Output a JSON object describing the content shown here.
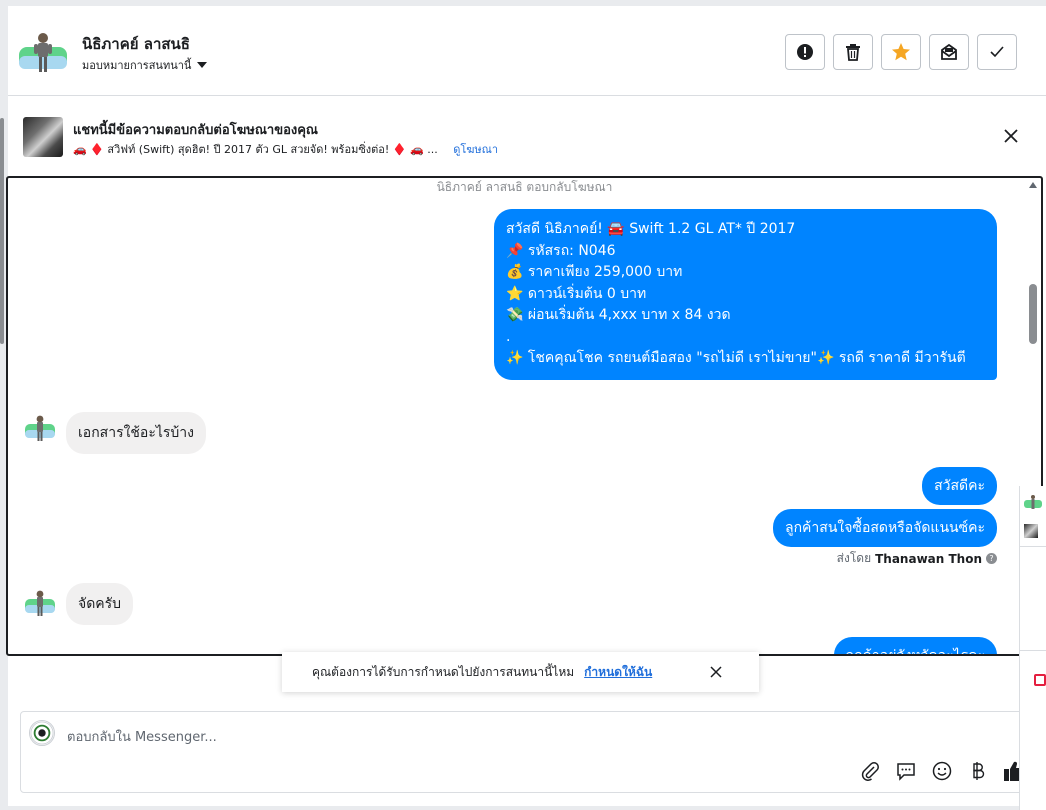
{
  "header": {
    "contact_name": "นิธิภาคย์ ลาสนธิ",
    "assign_label": "มอบหมายการสนทนานี้",
    "buttons": [
      {
        "name": "report-button",
        "icon": "alert-icon"
      },
      {
        "name": "delete-button",
        "icon": "trash-icon"
      },
      {
        "name": "star-button",
        "icon": "star-icon",
        "color": "#f5a623"
      },
      {
        "name": "mark-unread-button",
        "icon": "envelope-icon"
      },
      {
        "name": "done-button",
        "icon": "check-icon"
      }
    ]
  },
  "ad_banner": {
    "title": "แชทนี้มีข้อความตอบกลับต่อโฆษณาของคุณ",
    "text": "🚗 ♦️ สวิฟท์ (Swift) สุดฮิต! ปี 2017 ตัว GL สวยจัด! พร้อมซิ่งต่อ! ♦️ 🚗 ...",
    "link": "ดูโฆษณา"
  },
  "chat": {
    "replied_note": "นิธิภาคย์ ลาสนธิ ตอบกลับโฆษณา",
    "ad_message_lines": [
      "สวัสดี นิธิภาคย์! 🚘 Swift 1.2 GL AT* ปี 2017",
      " ",
      "📌 รหัสรถ: N046",
      "💰 ราคาเพียง 259,000 บาท",
      "⭐ ดาวน์เริ่มต้น 0 บาท",
      "💸 ผ่อนเริ่มต้น 4,xxx บาท x 84 งวด",
      ".",
      "✨ โชคคุณโชค รถยนต์มือสอง \"รถไม่ดี เราไม่ขาย\"✨ รถดี ราคาดี มีวารันตี"
    ],
    "msg_in_1": "เอกสารใช้อะไรบ้าง",
    "msg_out_1": "สวัสดีคะ",
    "msg_out_2": "ลูกค้าสนใจซื้อสดหรือจัดแนนซ์คะ",
    "sent_by_label": "ส่งโดย",
    "sent_by_name": "Thanawan Thon",
    "msg_in_2": "จัดครับ",
    "msg_out_3_partial": "ลูกค้าอยู่จังหวัดอะไรคะ"
  },
  "suggestion": {
    "text": "คุณต้องการได้รับการกำหนดไปยังการสนทนานี้ไหม",
    "action": "กำหนดให้ฉัน"
  },
  "composer": {
    "placeholder": "ตอบกลับใน Messenger...",
    "tools": [
      "attach-icon",
      "saved-reply-icon",
      "emoji-icon",
      "baht-icon",
      "thumbs-up-icon"
    ]
  },
  "colors": {
    "accent": "#0084ff",
    "link": "#216fdb",
    "star": "#f5a623"
  }
}
